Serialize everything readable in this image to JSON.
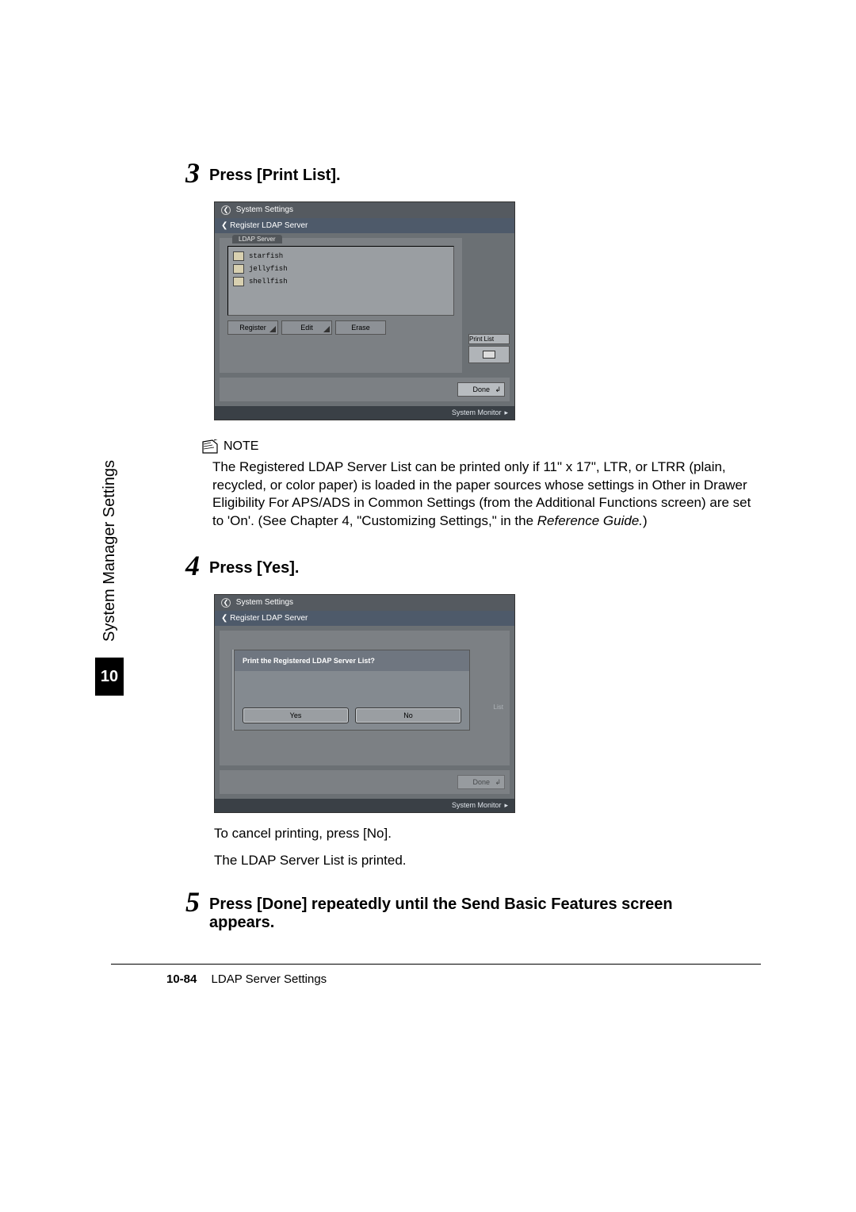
{
  "sidebar": {
    "section_title": "System Manager Settings",
    "chapter_number": "10"
  },
  "steps": {
    "s3": {
      "num": "3",
      "title": "Press [Print List]."
    },
    "s4": {
      "num": "4",
      "title": "Press [Yes]."
    },
    "s5": {
      "num": "5",
      "title": "Press [Done] repeatedly until the Send Basic Features screen appears."
    }
  },
  "shot1": {
    "title": "System Settings",
    "sub": "Register LDAP Server",
    "tab": "LDAP Server",
    "items": [
      "starfish",
      "jellyfish",
      "shellfish"
    ],
    "btn_register": "Register",
    "btn_edit": "Edit",
    "btn_erase": "Erase",
    "print_list_label": "Print List",
    "done": "Done",
    "status": "System Monitor"
  },
  "note": {
    "label": "NOTE",
    "text": "The Registered LDAP Server List can be printed only if 11\" x 17\", LTR, or LTRR (plain, recycled, or color paper) is loaded in the paper sources whose settings in Other in Drawer Eligibility For APS/ADS in Common Settings (from the Additional Functions screen) are set to 'On'. (See Chapter 4, \"Customizing Settings,\" in the ",
    "ref": "Reference Guide."
  },
  "shot2": {
    "title": "System Settings",
    "sub": "Register LDAP Server",
    "question": "Print the Registered LDAP Server List?",
    "yes": "Yes",
    "no": "No",
    "bg_label": "List",
    "done": "Done",
    "status": "System Monitor"
  },
  "after4": {
    "l1": "To cancel printing, press [No].",
    "l2": "The LDAP Server List is printed."
  },
  "footer": {
    "page": "10-84",
    "title": "LDAP Server Settings"
  },
  "close_paren": ")"
}
